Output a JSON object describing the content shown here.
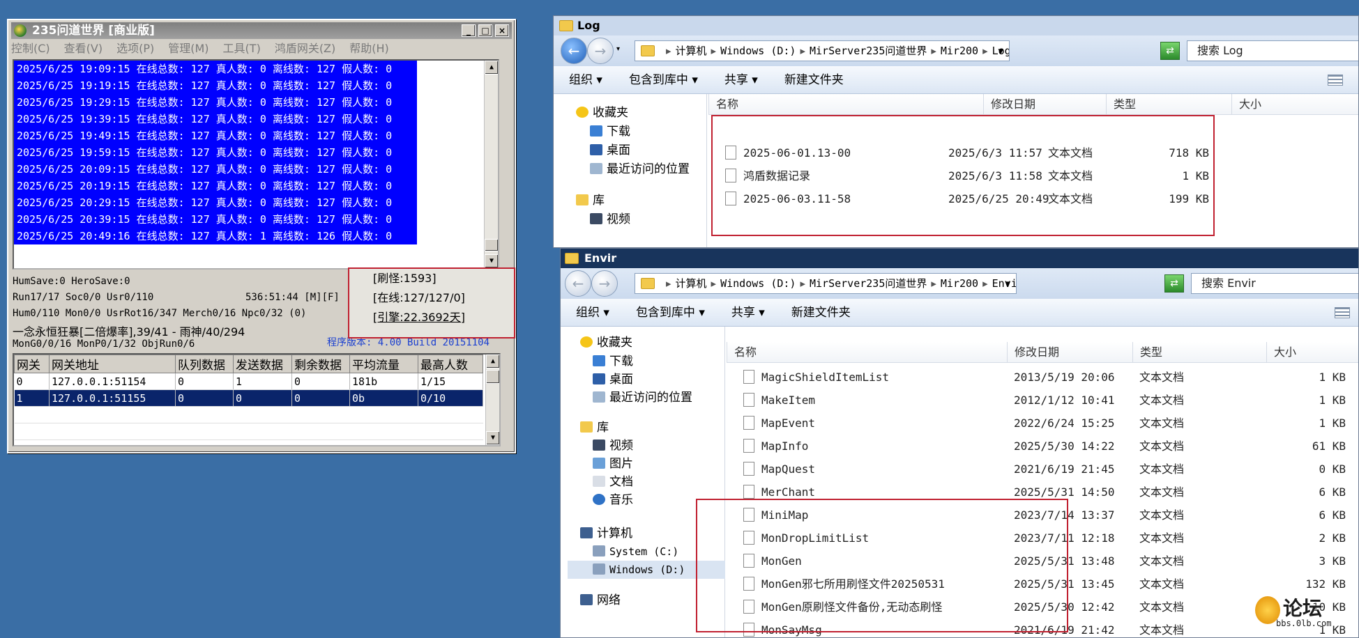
{
  "server": {
    "title": "235问道世界 [商业版]",
    "menu": [
      "控制(C)",
      "查看(V)",
      "选项(P)",
      "管理(M)",
      "工具(T)",
      "鸿盾网关(Z)",
      "帮助(H)"
    ],
    "log_lines": [
      "2025/6/25 19:09:15 在线总数: 127 真人数: 0 离线数: 127 假人数: 0",
      "2025/6/25 19:19:15 在线总数: 127 真人数: 0 离线数: 127 假人数: 0",
      "2025/6/25 19:29:15 在线总数: 127 真人数: 0 离线数: 127 假人数: 0",
      "2025/6/25 19:39:15 在线总数: 127 真人数: 0 离线数: 127 假人数: 0",
      "2025/6/25 19:49:15 在线总数: 127 真人数: 0 离线数: 127 假人数: 0",
      "2025/6/25 19:59:15 在线总数: 127 真人数: 0 离线数: 127 假人数: 0",
      "2025/6/25 20:09:15 在线总数: 127 真人数: 0 离线数: 127 假人数: 0",
      "2025/6/25 20:19:15 在线总数: 127 真人数: 0 离线数: 127 假人数: 0",
      "2025/6/25 20:29:15 在线总数: 127 真人数: 0 离线数: 127 假人数: 0",
      "2025/6/25 20:39:15 在线总数: 127 真人数: 0 离线数: 127 假人数: 0",
      "2025/6/25 20:49:16 在线总数: 127 真人数: 1 离线数: 126 假人数: 0"
    ],
    "status": {
      "line1": "HumSave:0 HeroSave:0",
      "line2": "Run17/17 Soc0/0 Usr0/110",
      "line2_time": "536:51:44 [M][F]",
      "line3": "Hum0/110 Mon0/0 UsrRot16/347 Merch0/16 Npc0/32 (0)",
      "line4": "一念永恒狂暴[二倍爆率],39/41 - 雨神/40/294",
      "line5": "MonG0/0/16 MonP0/1/32 ObjRun0/6",
      "version": "程序版本: 4.00 Build 20151104"
    },
    "statbox": [
      "[刷怪:1593]",
      "[在线:127/127/0]",
      "[引擎:22.3692天]"
    ],
    "gateway": {
      "headers": [
        "网关",
        "网关地址",
        "队列数据",
        "发送数据",
        "剩余数据",
        "平均流量",
        "最高人数"
      ],
      "rows": [
        [
          "0",
          "127.0.0.1:51154",
          "0",
          "1",
          "0",
          "181b",
          "1/15"
        ],
        [
          "1",
          "127.0.0.1:51155",
          "0",
          "0",
          "0",
          "0b",
          "0/10"
        ]
      ]
    }
  },
  "log_window": {
    "title": "Log",
    "breadcrumb": [
      "计算机",
      "Windows (D:)",
      "MirServer235问道世界",
      "Mir200",
      "Log"
    ],
    "search_placeholder": "搜索 Log",
    "commands": [
      "组织 ▾",
      "包含到库中 ▾",
      "共享 ▾",
      "新建文件夹"
    ],
    "nav": [
      "收藏夹",
      "下载",
      "桌面",
      "最近访问的位置",
      "库",
      "视频"
    ],
    "columns": [
      "名称",
      "修改日期",
      "类型",
      "大小"
    ],
    "files": [
      {
        "name": "2025-06-01.13-00",
        "date": "2025/6/3 11:57",
        "type": "文本文档",
        "size": "718 KB"
      },
      {
        "name": "鸿盾数据记录",
        "date": "2025/6/3 11:58",
        "type": "文本文档",
        "size": "1 KB"
      },
      {
        "name": "2025-06-03.11-58",
        "date": "2025/6/25 20:49",
        "type": "文本文档",
        "size": "199 KB"
      }
    ]
  },
  "envir_window": {
    "title": "Envir",
    "breadcrumb": [
      "计算机",
      "Windows (D:)",
      "MirServer235问道世界",
      "Mir200",
      "Envir"
    ],
    "search_placeholder": "搜索 Envir",
    "commands": [
      "组织 ▾",
      "包含到库中 ▾",
      "共享 ▾",
      "新建文件夹"
    ],
    "nav": [
      "收藏夹",
      "下载",
      "桌面",
      "最近访问的位置",
      "库",
      "视频",
      "图片",
      "文档",
      "音乐",
      "计算机",
      "System (C:)",
      "Windows (D:)",
      "网络"
    ],
    "columns": [
      "名称",
      "修改日期",
      "类型",
      "大小"
    ],
    "files": [
      {
        "name": "MagicShieldItemList",
        "date": "2013/5/19 20:06",
        "type": "文本文档",
        "size": "1 KB"
      },
      {
        "name": "MakeItem",
        "date": "2012/1/12 10:41",
        "type": "文本文档",
        "size": "1 KB"
      },
      {
        "name": "MapEvent",
        "date": "2022/6/24 15:25",
        "type": "文本文档",
        "size": "1 KB"
      },
      {
        "name": "MapInfo",
        "date": "2025/5/30 14:22",
        "type": "文本文档",
        "size": "61 KB"
      },
      {
        "name": "MapQuest",
        "date": "2021/6/19 21:45",
        "type": "文本文档",
        "size": "0 KB"
      },
      {
        "name": "MerChant",
        "date": "2025/5/31 14:50",
        "type": "文本文档",
        "size": "6 KB"
      },
      {
        "name": "MiniMap",
        "date": "2023/7/14 13:37",
        "type": "文本文档",
        "size": "6 KB"
      },
      {
        "name": "MonDropLimitList",
        "date": "2023/7/11 12:18",
        "type": "文本文档",
        "size": "2 KB"
      },
      {
        "name": "MonGen",
        "date": "2025/5/31 13:48",
        "type": "文本文档",
        "size": "3 KB"
      },
      {
        "name": "MonGen邪七所用刷怪文件20250531",
        "date": "2025/5/31 13:45",
        "type": "文本文档",
        "size": "132 KB"
      },
      {
        "name": "MonGen原刷怪文件备份,无动态刷怪",
        "date": "2025/5/30 12:42",
        "type": "文本文档",
        "size": "10 KB"
      },
      {
        "name": "MonSayMsg",
        "date": "2021/6/19 21:42",
        "type": "文本文档",
        "size": "1 KB"
      }
    ]
  },
  "watermark": {
    "brand": "论坛",
    "url": "bbs.0lb.com"
  },
  "colors": {
    "desktop": "#3a6ea5",
    "selection": "#0000ff",
    "highlight_box": "#c02030",
    "envir_title": "#18345c"
  }
}
